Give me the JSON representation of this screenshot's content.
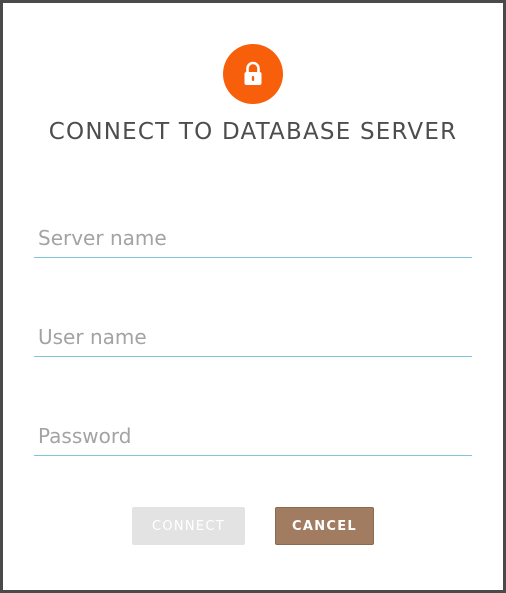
{
  "dialog": {
    "title": "CONNECT TO DATABASE SERVER",
    "icon": "lock-icon",
    "accent_color": "#f75f0a",
    "fields": {
      "server_name": {
        "value": "",
        "placeholder": "Server name"
      },
      "user_name": {
        "value": "",
        "placeholder": "User name"
      },
      "password": {
        "value": "",
        "placeholder": "Password"
      }
    },
    "buttons": {
      "connect_label": "CONNECT",
      "connect_state": "disabled",
      "cancel_label": "CANCEL",
      "cancel_color": "#a17c61"
    }
  }
}
